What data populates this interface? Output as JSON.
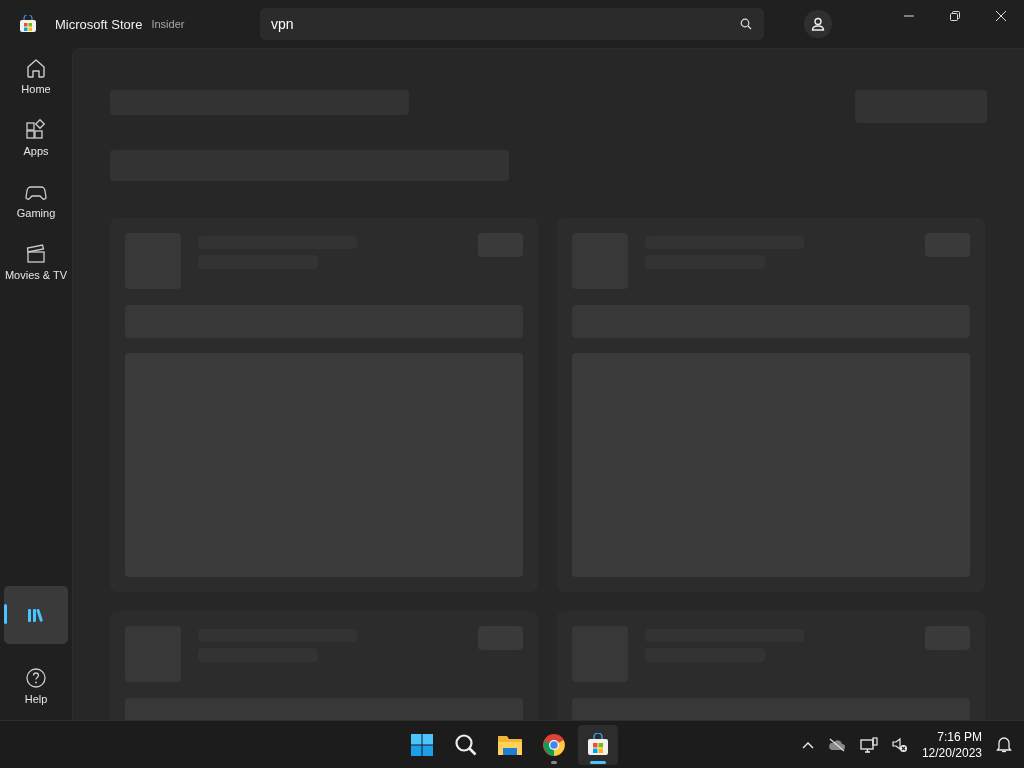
{
  "window": {
    "app_name": "Microsoft Store",
    "channel": "Insider"
  },
  "search": {
    "value": "vpn"
  },
  "sidebar": {
    "items": [
      {
        "label": "Home",
        "selected": false
      },
      {
        "label": "Apps",
        "selected": false
      },
      {
        "label": "Gaming",
        "selected": false
      },
      {
        "label": "Movies & TV",
        "selected": false
      },
      {
        "selected": true
      },
      {
        "label": "Help",
        "selected": false
      }
    ]
  },
  "taskbar": {
    "apps": [
      {
        "running": false,
        "active": false
      },
      {
        "running": false,
        "active": false
      },
      {
        "running": false,
        "active": false
      },
      {
        "running": true,
        "active": false
      },
      {
        "running": true,
        "active": true
      }
    ],
    "time": "7:16 PM",
    "date": "12/20/2023"
  }
}
